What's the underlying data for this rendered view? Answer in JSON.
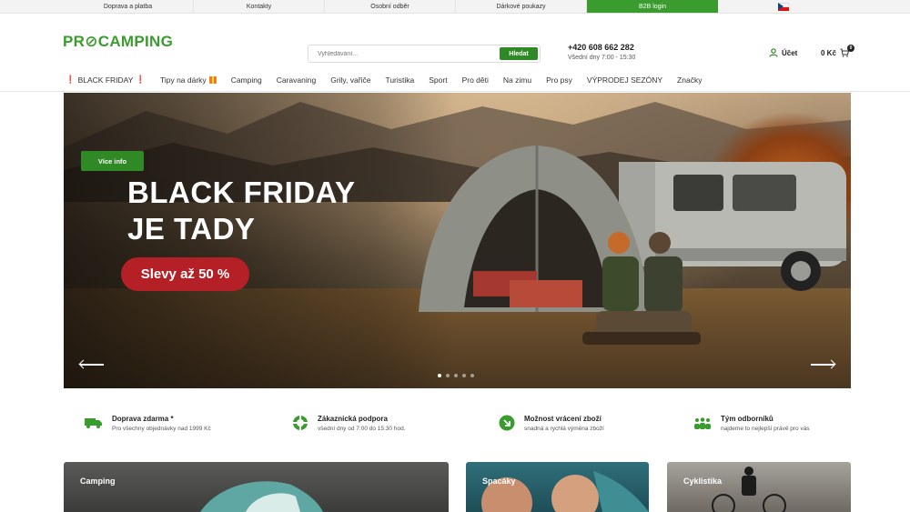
{
  "topbar": {
    "items": [
      "Doprava a platba",
      "Kontakty",
      "Osobní odběr",
      "Dárkové poukazy",
      "B2B login"
    ]
  },
  "header": {
    "logo": "PR⊘CAMPING",
    "search_placeholder": "Vyhledávání...",
    "search_button": "Hledat",
    "phone": "+420 608 662 282",
    "hours": "Všední dny 7:00 - 15:30",
    "account": "Účet",
    "cart_total": "0 Kč",
    "cart_count": "0"
  },
  "nav": {
    "items": [
      "BLACK FRIDAY",
      "Tipy na dárky",
      "Camping",
      "Caravaning",
      "Grily, vařiče",
      "Turistika",
      "Sport",
      "Pro děti",
      "Na zimu",
      "Pro psy",
      "VÝPRODEJ SEZÓNY",
      "Značky"
    ]
  },
  "hero": {
    "info_button": "Více info",
    "title_line1": "BLACK FRIDAY",
    "title_line2": "JE TADY",
    "sale_badge": "Slevy až 50 %",
    "slide_count": 5,
    "active_slide": 1
  },
  "features": [
    {
      "title": "Doprava zdarma *",
      "desc": "Pro všechny objednávky nad 1999 Kč",
      "icon": "truck-icon"
    },
    {
      "title": "Zákaznická podpora",
      "desc": "všední dny od 7:00 do 15:30 hod.",
      "icon": "lifebuoy-icon"
    },
    {
      "title": "Možnost vrácení zboží",
      "desc": "snadná a rychlá výměna zboží",
      "icon": "return-arrow-icon"
    },
    {
      "title": "Tým odborníků",
      "desc": "najdeme to nejlepší právě pro vás",
      "icon": "team-icon"
    }
  ],
  "categories": [
    "Camping",
    "Spacáky",
    "Cyklistika"
  ],
  "colors": {
    "brand_green": "#3a9b2e",
    "button_green": "#2f8a26",
    "sale_red": "#b51f26"
  }
}
